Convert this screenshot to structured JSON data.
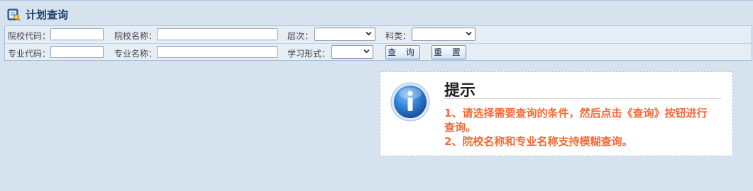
{
  "header": {
    "title": "计划查询",
    "icon": "plan-search-icon"
  },
  "form": {
    "school_code_label": "院校代码：",
    "school_code_value": "",
    "school_name_label": "院校名称：",
    "school_name_value": "",
    "level_label": "层次：",
    "level_selected": "",
    "subject_label": "科类：",
    "subject_selected": "",
    "major_code_label": "专业代码：",
    "major_code_value": "",
    "major_name_label": "专业名称：",
    "major_name_value": "",
    "study_form_label": "学习形式：",
    "study_form_selected": "",
    "query_button": "查 询",
    "reset_button": "重 置"
  },
  "tip": {
    "icon": "info-icon",
    "title": "提示",
    "lines": [
      "1、请选择需要查询的条件，然后点击《查询》按钮进行查询。",
      "2、院校名称和专业名称支持模糊查询。"
    ]
  },
  "colors": {
    "tip_text": "#f26b3a",
    "background": "#d6e3ef",
    "title": "#1d3f6c"
  }
}
